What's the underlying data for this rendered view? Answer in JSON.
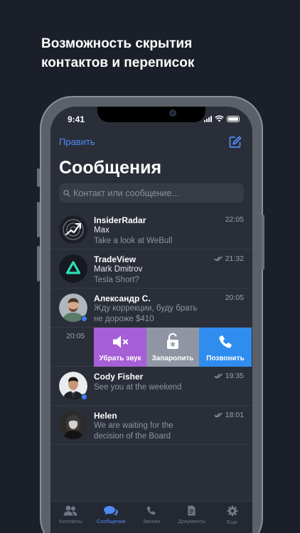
{
  "headline": {
    "line1": "Возможность скрытия",
    "line2": "контактов и переписок"
  },
  "status_bar": {
    "time": "9:41"
  },
  "header": {
    "edit_label": "Править",
    "title": "Сообщения",
    "compose_icon": "compose-icon"
  },
  "search": {
    "placeholder": "Контакт или сообщение..."
  },
  "chats": [
    {
      "name": "InsiderRadar",
      "line2": "Max",
      "preview": [
        "Take a look at WeBull"
      ],
      "time": "22:05",
      "read": false
    },
    {
      "name": "TradeView",
      "line2": "Mark Dmitrov",
      "preview": [
        "Tesla Short?"
      ],
      "time": "21:32",
      "read": true
    },
    {
      "name": "Александр С.",
      "line2": "",
      "preview": [
        "Жду коррекции, буду брать",
        "не дороже $410"
      ],
      "time": "20:05",
      "read": false,
      "online": true
    },
    {
      "name": "",
      "line2": "",
      "preview": [],
      "time": "20:05",
      "swiped": true
    },
    {
      "name": "Cody Fisher",
      "line2": "",
      "preview": [
        "See you at the weekend"
      ],
      "time": "19:35",
      "read": true,
      "online": true
    },
    {
      "name": "Helen",
      "line2": "",
      "preview": [
        "We are waiting for the",
        "decision of the Board"
      ],
      "time": "18:01",
      "read": true
    }
  ],
  "swipe_actions": [
    {
      "label": "Убрать звук",
      "icon": "mute-icon",
      "color": "#a65fd6"
    },
    {
      "label": "Запаролить",
      "icon": "lock-icon",
      "color": "#8f95a3"
    },
    {
      "label": "Позвонить",
      "icon": "phone-icon",
      "color": "#2f8df0"
    }
  ],
  "tabs": [
    {
      "label": "Контакты",
      "icon": "contacts-icon",
      "active": false
    },
    {
      "label": "Сообщения",
      "icon": "chat-icon",
      "active": true
    },
    {
      "label": "Звонки",
      "icon": "phone-icon",
      "active": false
    },
    {
      "label": "Документы",
      "icon": "document-icon",
      "active": false
    },
    {
      "label": "Еще",
      "icon": "gear-icon",
      "active": false
    }
  ],
  "colors": {
    "background": "#1b1f29",
    "screen": "#2a2e38",
    "accent": "#4d8cf5"
  }
}
